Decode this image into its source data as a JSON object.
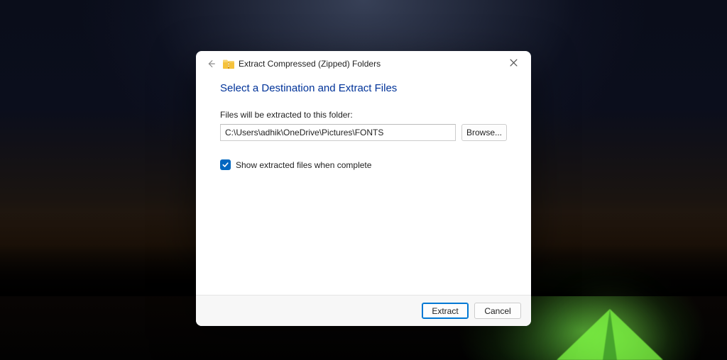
{
  "dialog": {
    "title": "Extract Compressed (Zipped) Folders",
    "heading": "Select a Destination and Extract Files",
    "field_label": "Files will be extracted to this folder:",
    "path_value": "C:\\Users\\adhik\\OneDrive\\Pictures\\FONTS",
    "browse_label": "Browse...",
    "checkbox_label": "Show extracted files when complete",
    "checkbox_checked": true,
    "extract_label": "Extract",
    "cancel_label": "Cancel"
  }
}
